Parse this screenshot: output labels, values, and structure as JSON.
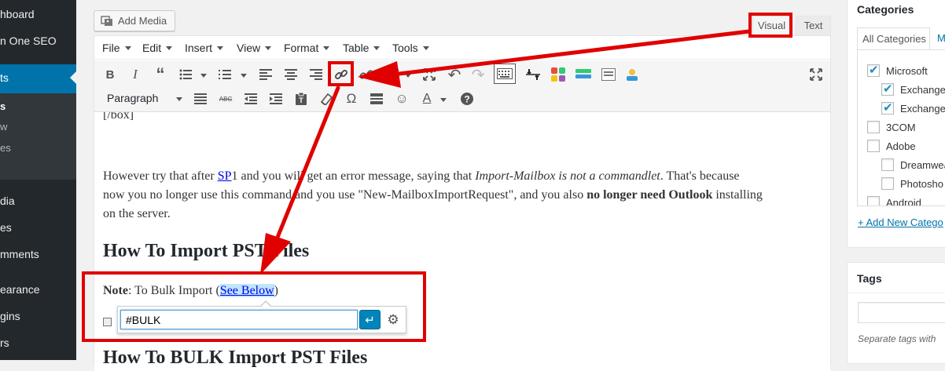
{
  "sidebar": {
    "items": [
      {
        "label": "hboard"
      },
      {
        "label": "n One SEO"
      },
      {
        "label": "ts"
      },
      {
        "label": "dia"
      },
      {
        "label": "es"
      },
      {
        "label": "mments"
      },
      {
        "label": "earance"
      },
      {
        "label": "gins"
      },
      {
        "label": "rs"
      }
    ],
    "submenu": [
      "s",
      "w",
      "es",
      ""
    ]
  },
  "editor": {
    "add_media_label": "Add Media",
    "tab_visual": "Visual",
    "tab_text": "Text",
    "menubar": [
      "File",
      "Edit",
      "Insert",
      "View",
      "Format",
      "Table",
      "Tools"
    ],
    "format_select": "Paragraph"
  },
  "content": {
    "code_tail": "[/box]",
    "para1_line1_a": "However try that after ",
    "para1_link": "SP",
    "para1_line1_b": "1 and you will get an error message, saying that ",
    "para1_line1_italic": "Import-Mailbox is not a commandlet",
    "para1_line1_c": ". That's because",
    "para1_line2_a": "now you no longer use this command and you use \"New-MailboxImportRequest\", and you also ",
    "para1_line2_bold": "no longer need Outlook",
    "para1_line2_b": " installing",
    "para1_line3": "on the server.",
    "heading1": "How To Import PST Files",
    "note_label": "Note",
    "note_text": ": To Bulk Import (",
    "note_link": "See Below",
    "note_close": ")",
    "heading2": "How To BULK Import PST Files"
  },
  "link_dialog": {
    "url_value": "#BULK",
    "apply_icon": "↵"
  },
  "categories": {
    "title": "Categories",
    "tab_all": "All Categories",
    "tab_most": "M",
    "items": [
      {
        "label": "Microsoft",
        "checked": true,
        "indent": 0
      },
      {
        "label": "Exchange",
        "checked": true,
        "indent": 1
      },
      {
        "label": "Exchange",
        "checked": true,
        "indent": 1
      },
      {
        "label": "3COM",
        "checked": false,
        "indent": 0
      },
      {
        "label": "Adobe",
        "checked": false,
        "indent": 0
      },
      {
        "label": "Dreamwea",
        "checked": false,
        "indent": 1
      },
      {
        "label": "Photosho",
        "checked": false,
        "indent": 1
      },
      {
        "label": "Android",
        "checked": false,
        "indent": 0
      }
    ],
    "add_new": "+ Add New Catego"
  },
  "tags": {
    "title": "Tags",
    "hint": "Separate tags with"
  },
  "colors": {
    "sidebar_bg": "#23282d",
    "sidebar_current": "#0073aa",
    "annotation_red": "#e00000",
    "link_blue": "#0073aa"
  }
}
